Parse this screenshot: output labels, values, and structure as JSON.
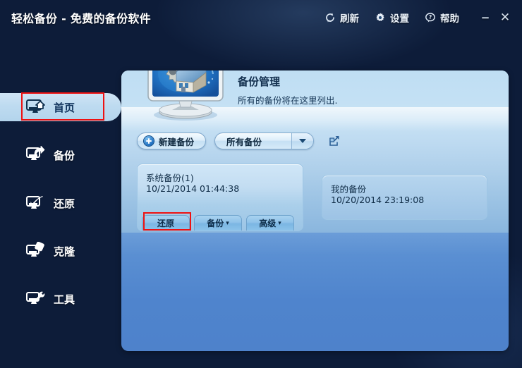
{
  "window": {
    "title": "轻松备份 - 免费的备份软件",
    "tools": [
      {
        "label": "刷新",
        "icon": "refresh-icon"
      },
      {
        "label": "设置",
        "icon": "gear-icon"
      },
      {
        "label": "帮助",
        "icon": "help-icon"
      }
    ],
    "minimize": "−",
    "close": "✕"
  },
  "sidebar": {
    "items": [
      {
        "label": "首页",
        "icon": "monitor-home-icon",
        "active": true
      },
      {
        "label": "备份",
        "icon": "monitor-backup-icon",
        "active": false
      },
      {
        "label": "还原",
        "icon": "monitor-restore-icon",
        "active": false
      },
      {
        "label": "克隆",
        "icon": "monitor-clone-icon",
        "active": false
      },
      {
        "label": "工具",
        "icon": "monitor-tools-icon",
        "active": false
      }
    ]
  },
  "main": {
    "hero": {
      "title": "备份管理",
      "subtitle": "所有的备份将在这里列出.",
      "icon": "monitor-gear-house-icon"
    },
    "commandbar": {
      "new_backup_label": "新建备份",
      "filter_selected": "所有备份",
      "export_icon": "export-icon"
    },
    "cards": [
      {
        "title": "系统备份(1)",
        "date": "10/21/2014 01:44:38",
        "actions": [
          {
            "label": "还原",
            "has_chevron": false,
            "highlighted": true
          },
          {
            "label": "备份",
            "has_chevron": true,
            "highlighted": false
          },
          {
            "label": "高级",
            "has_chevron": true,
            "highlighted": false
          }
        ]
      },
      {
        "title": "我的备份",
        "date": "10/20/2014 23:19:08",
        "actions": []
      }
    ]
  },
  "annotations": {
    "highlight_color": "#ee1111",
    "boxes": [
      "sidebar-home-item",
      "restore-button"
    ]
  }
}
